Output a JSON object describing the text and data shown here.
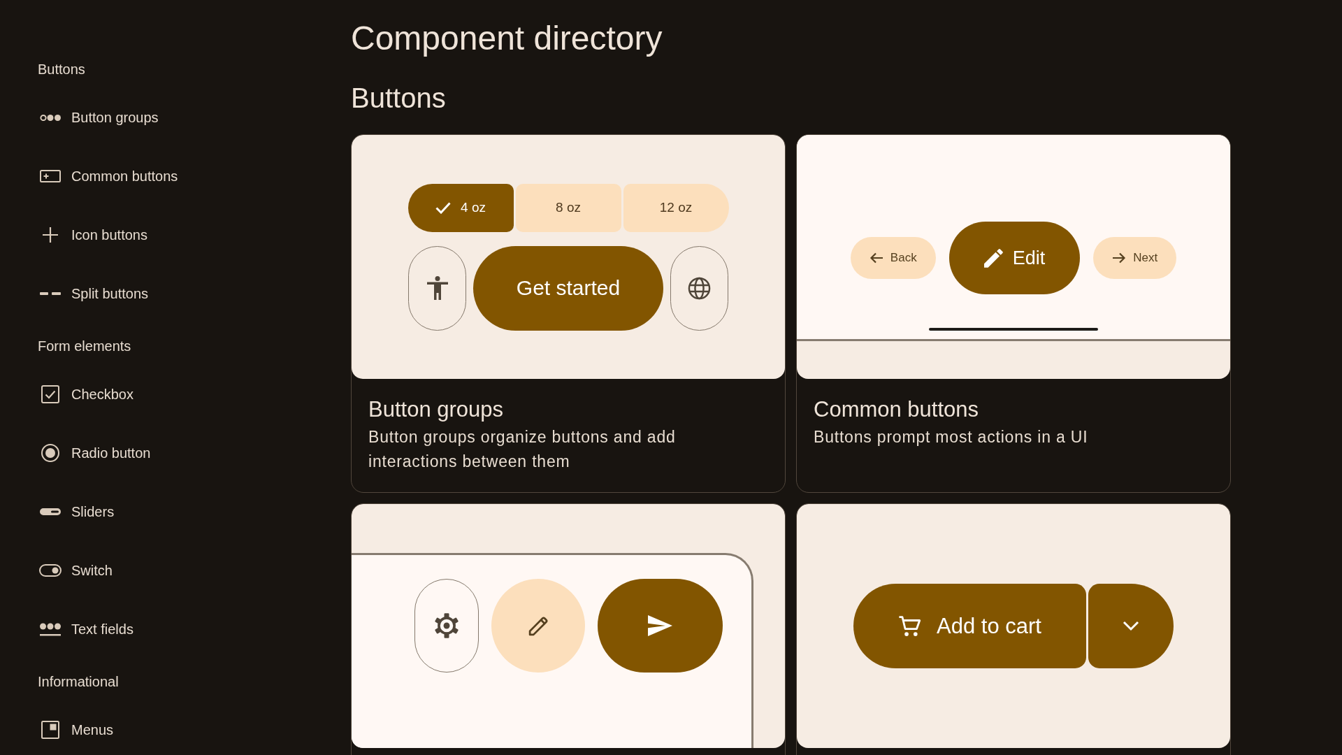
{
  "sidebar": {
    "sections": [
      {
        "heading": "Buttons",
        "items": [
          {
            "label": "Button groups",
            "selected": false
          },
          {
            "label": "Common buttons",
            "selected": false
          },
          {
            "label": "Icon buttons",
            "selected": false
          },
          {
            "label": "Split buttons",
            "selected": false
          }
        ]
      },
      {
        "heading": "Form elements",
        "items": [
          {
            "label": "Checkbox",
            "selected": false
          },
          {
            "label": "Radio button",
            "selected": false
          },
          {
            "label": "Sliders",
            "selected": false
          },
          {
            "label": "Switch",
            "selected": false
          },
          {
            "label": "Text fields",
            "selected": false
          }
        ]
      },
      {
        "heading": "Informational",
        "items": [
          {
            "label": "Menus",
            "selected": false
          }
        ]
      }
    ]
  },
  "title": "Component directory",
  "section": {
    "heading": "Buttons",
    "cards": [
      {
        "title": "Button groups",
        "description": "Button groups organize buttons and add interactions between them",
        "preview": {
          "kind": "button_groups",
          "segments": [
            {
              "label": "4 oz",
              "selected": true
            },
            {
              "label": "8 oz",
              "selected": false
            },
            {
              "label": "12 oz",
              "selected": false
            }
          ],
          "buttons": [
            {
              "kind": "outlined"
            },
            {
              "kind": "filled",
              "label": "Get started"
            },
            {
              "kind": "outlined"
            }
          ]
        }
      },
      {
        "title": "Common buttons",
        "description": "Buttons prompt most actions in a UI",
        "preview": {
          "kind": "common_buttons",
          "buttons": [
            {
              "kind": "tonal",
              "label": "Back"
            },
            {
              "kind": "filled",
              "label": "Edit"
            },
            {
              "kind": "tonal",
              "label": "Next"
            }
          ]
        }
      },
      {
        "preview": {
          "kind": "icon_buttons",
          "buttons": [
            {
              "kind": "outlined"
            },
            {
              "kind": "tonal"
            },
            {
              "kind": "filled"
            }
          ]
        }
      },
      {
        "preview": {
          "kind": "split_buttons",
          "label": "Add to cart"
        }
      }
    ]
  }
}
